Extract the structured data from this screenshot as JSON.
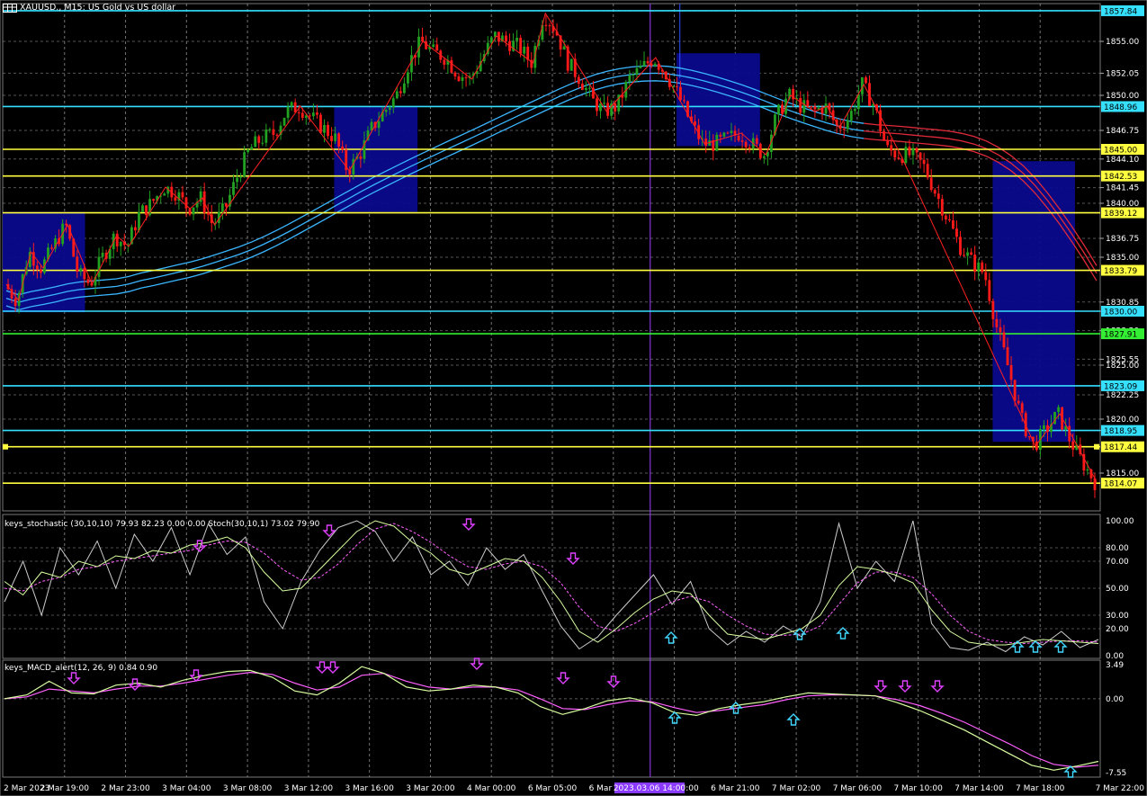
{
  "header": {
    "title": "XAUUSD., M15:  US Gold vs US dollar",
    "stoch_label": "keys_stochastic (30,10,10) 79.93 82.23 0.00 0.00 Stoch(30,10,1) 73.02 79.90",
    "macd_label": "keys_MACD_alert(12, 26, 9) 0.84 0.90"
  },
  "colors": {
    "bull": "#22a022",
    "bear": "#ff1a1a",
    "zone": "#0a0a8c",
    "cyan_line": "#35e0ff",
    "yellow_line": "#ffff40",
    "green_line": "#33ee33",
    "ma_blue": "#3ab6ff",
    "ma_red": "#e02a3a",
    "zigzag": "#ff2020",
    "grid": "#9a9a9a",
    "stoch_main": "#d8ffa0",
    "stoch_signal": "#ff60ff",
    "stoch_raw": "#cccccc",
    "arrow_down": "#e040ff",
    "arrow_up": "#40d8ff"
  },
  "chart_data": {
    "type": "candlestick",
    "symbol": "XAUUSD.",
    "timeframe": "M15",
    "ylim": [
      1811.5,
      1858.5
    ],
    "y_ticks": [
      "1857.85",
      "1855.00",
      "1852.05",
      "1850.00",
      "1846.75",
      "1845.00",
      "1844.10",
      "1841.45",
      "1840.00",
      "1836.75",
      "1835.00",
      "1830.85",
      "1830.00",
      "1828.20",
      "1825.55",
      "1825.00",
      "1822.25",
      "1820.00",
      "1818.95",
      "1815.00"
    ],
    "x_labels": [
      "2 Mar 2023",
      "2 Mar 19:00",
      "2 Mar 23:00",
      "3 Mar 04:00",
      "3 Mar 08:00",
      "3 Mar 12:00",
      "3 Mar 16:00",
      "3 Mar 20:00",
      "4 Mar 00:00",
      "6 Mar 05:00",
      "6 Mar 09:00",
      "6 Mar 17:00",
      "6 Mar 21:00",
      "7 Mar 02:00",
      "7 Mar 06:00",
      "7 Mar 10:00",
      "7 Mar 14:00",
      "7 Mar 18:00",
      "7 Mar 22:00"
    ],
    "cursor_label": "2023.03.06 14:00",
    "price_path": [
      1832.5,
      1831,
      1835.5,
      1834,
      1836,
      1838,
      1833.5,
      1832.5,
      1835,
      1837,
      1836,
      1839,
      1840,
      1841.5,
      1841,
      1839.5,
      1840.5,
      1838,
      1839.5,
      1842.5,
      1845,
      1846,
      1846.5,
      1848.5,
      1849,
      1848,
      1847,
      1846,
      1843,
      1844.5,
      1847,
      1848.5,
      1850,
      1853,
      1855,
      1854,
      1853.5,
      1852,
      1851.5,
      1853.5,
      1855.5,
      1855,
      1854.5,
      1853,
      1857.6,
      1856,
      1853,
      1851.5,
      1849.5,
      1848.5,
      1849,
      1851.5,
      1852.5,
      1853.5,
      1852,
      1850,
      1847.5,
      1845.5,
      1845.5,
      1846,
      1846.5,
      1845.5,
      1844.5,
      1848,
      1850,
      1849,
      1848.5,
      1849,
      1847,
      1848,
      1851,
      1849,
      1845,
      1844.5,
      1844.5,
      1843.5,
      1841,
      1838.5,
      1836,
      1834.5,
      1833.5,
      1828.5,
      1824.5,
      1820,
      1817.5,
      1819,
      1820.5,
      1818,
      1816,
      1814.2
    ],
    "horizontal_levels": [
      {
        "price": "1857.84",
        "color": "cyan"
      },
      {
        "price": "1848.96",
        "color": "cyan"
      },
      {
        "price": "1845.00",
        "color": "yellow"
      },
      {
        "price": "1842.53",
        "color": "yellow"
      },
      {
        "price": "1839.12",
        "color": "yellow"
      },
      {
        "price": "1833.79",
        "color": "yellow"
      },
      {
        "price": "1830.00",
        "color": "cyan"
      },
      {
        "price": "1827.91",
        "color": "green"
      },
      {
        "price": "1823.09",
        "color": "cyan"
      },
      {
        "price": "1818.95",
        "color": "cyan"
      },
      {
        "price": "1817.44",
        "color": "yellow"
      },
      {
        "price": "1814.07",
        "color": "yellow"
      }
    ],
    "zones": [
      {
        "x0": 0.0,
        "x1": 0.075,
        "y_top": 1839.2,
        "y_bot": 1829.9
      },
      {
        "x0": 0.302,
        "x1": 0.378,
        "y_top": 1848.9,
        "y_bot": 1839.2
      },
      {
        "x0": 0.614,
        "x1": 0.69,
        "y_top": 1853.9,
        "y_bot": 1845.3
      },
      {
        "x0": 0.902,
        "x1": 0.977,
        "y_top": 1843.9,
        "y_bot": 1817.9
      }
    ],
    "stochastic": {
      "ylim": [
        0,
        100
      ],
      "y_ticks": [
        "100.00",
        "80.00",
        "70.00",
        "50.00",
        "30.00",
        "20.00",
        "0.00"
      ],
      "main": [
        55,
        45,
        62,
        58,
        70,
        66,
        74,
        72,
        78,
        76,
        82,
        84,
        88,
        80,
        62,
        48,
        50,
        64,
        78,
        92,
        100,
        96,
        84,
        76,
        64,
        60,
        66,
        72,
        70,
        58,
        40,
        18,
        10,
        20,
        32,
        42,
        48,
        46,
        30,
        16,
        14,
        12,
        16,
        20,
        30,
        52,
        66,
        64,
        60,
        54,
        34,
        18,
        10,
        8,
        8,
        10,
        12,
        11,
        10,
        9
      ],
      "signal": [
        50,
        48,
        55,
        58,
        64,
        66,
        70,
        72,
        74,
        76,
        78,
        82,
        85,
        84,
        76,
        64,
        56,
        58,
        68,
        82,
        94,
        98,
        92,
        84,
        74,
        66,
        64,
        68,
        70,
        66,
        54,
        36,
        22,
        18,
        24,
        32,
        40,
        44,
        40,
        30,
        22,
        16,
        15,
        16,
        22,
        38,
        54,
        62,
        62,
        58,
        46,
        30,
        18,
        12,
        10,
        9,
        10,
        11,
        11,
        10
      ],
      "raw": [
        40,
        70,
        30,
        80,
        60,
        85,
        50,
        90,
        70,
        95,
        60,
        98,
        75,
        88,
        40,
        20,
        55,
        78,
        95,
        100,
        92,
        70,
        88,
        60,
        70,
        52,
        80,
        64,
        75,
        48,
        22,
        5,
        14,
        30,
        45,
        60,
        38,
        55,
        20,
        8,
        18,
        10,
        22,
        14,
        40,
        98,
        50,
        70,
        55,
        100,
        24,
        6,
        4,
        10,
        3,
        14,
        8,
        18,
        6,
        12
      ]
    },
    "macd": {
      "ylim": [
        -7.55,
        3.49
      ],
      "y_ticks": [
        "3.49",
        "0.00",
        "-7.55"
      ],
      "main": [
        0,
        0.4,
        1.8,
        0.6,
        0.5,
        1.4,
        1.6,
        1.2,
        1.9,
        2.4,
        2.8,
        2.9,
        2.2,
        0.8,
        0.4,
        1.6,
        3.3,
        2.6,
        1.2,
        0.8,
        1.0,
        1.4,
        1.2,
        0.6,
        -0.8,
        -1.6,
        -1.0,
        -0.2,
        0.1,
        -0.4,
        -1.4,
        -1.7,
        -1.0,
        -0.6,
        -0.3,
        0.2,
        0.6,
        0.5,
        0.4,
        0.3,
        -0.4,
        -1.2,
        -2.2,
        -3.2,
        -4.4,
        -5.6,
        -6.8,
        -7.3,
        -6.9,
        -6.4
      ],
      "signal": [
        0,
        0.2,
        1.0,
        0.8,
        0.6,
        1.0,
        1.3,
        1.3,
        1.6,
        2.0,
        2.4,
        2.7,
        2.5,
        1.6,
        0.9,
        1.2,
        2.4,
        2.6,
        1.8,
        1.2,
        1.0,
        1.2,
        1.2,
        0.9,
        0.0,
        -1.0,
        -1.1,
        -0.6,
        -0.2,
        -0.3,
        -0.9,
        -1.4,
        -1.2,
        -0.9,
        -0.6,
        -0.1,
        0.3,
        0.4,
        0.4,
        0.3,
        -0.1,
        -0.7,
        -1.5,
        -2.4,
        -3.5,
        -4.6,
        -5.8,
        -6.7,
        -7.0,
        -6.8
      ]
    }
  }
}
